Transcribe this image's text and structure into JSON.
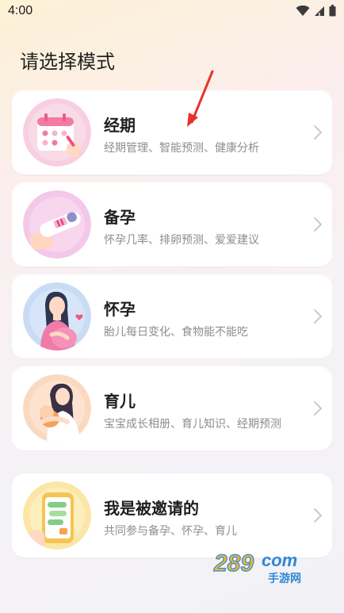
{
  "status_bar": {
    "time": "4:00"
  },
  "page": {
    "title": "请选择模式"
  },
  "cards": [
    {
      "title": "经期",
      "subtitle": "经期管理、智能预测、健康分析"
    },
    {
      "title": "备孕",
      "subtitle": "怀孕几率、排卵预测、爱爱建议"
    },
    {
      "title": "怀孕",
      "subtitle": "胎儿每日变化、食物能不能吃"
    },
    {
      "title": "育儿",
      "subtitle": "宝宝成长相册、育儿知识、经期预测"
    },
    {
      "title": "我是被邀请的",
      "subtitle": "共同参与备孕、怀孕、育儿"
    }
  ],
  "watermark": {
    "brand": "289",
    "suffix": "com",
    "tagline": "手游网"
  },
  "icons": {
    "status": [
      "wifi-icon",
      "signal-icon",
      "battery-icon"
    ],
    "chevron": "chevron-right-icon"
  },
  "colors": {
    "accent_arrow": "#e5332a",
    "title": "#1e1e1e",
    "subtitle": "#8d8d8d"
  }
}
